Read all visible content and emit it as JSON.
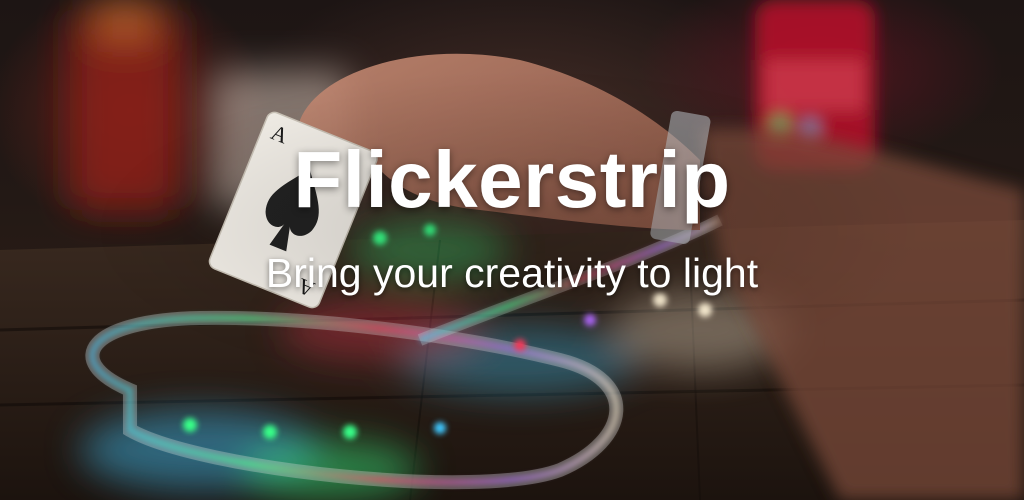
{
  "banner": {
    "title": "Flickerstrip",
    "tagline": "Bring your creativity to light",
    "card_rank": "A"
  },
  "colors": {
    "text": "#ffffff",
    "led_red": "#ff3b5c",
    "led_green": "#39ff88",
    "led_blue": "#3fc8ff",
    "led_purple": "#b26bff",
    "led_white": "#fff2d6",
    "bottle_red": "#c0142c"
  }
}
